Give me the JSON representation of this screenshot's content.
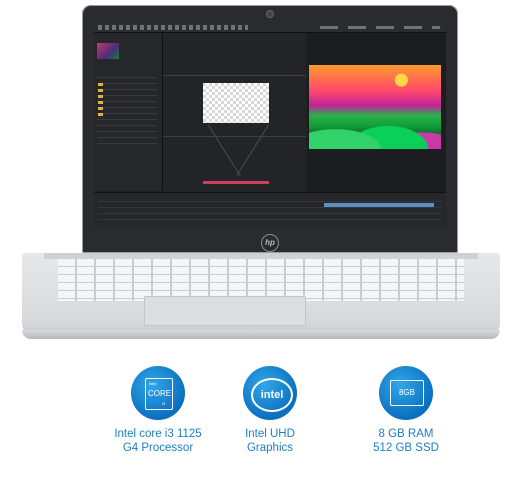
{
  "features": [
    {
      "icon": "intel-core-i3-icon",
      "badge_top": "intel",
      "badge_main": "CORE",
      "badge_sub": "i3",
      "line1": "Intel core i3 1125",
      "line2": "G4 Processor"
    },
    {
      "icon": "intel-uhd-icon",
      "badge_main": "intel",
      "line1": "Intel UHD",
      "line2": "Graphics"
    },
    {
      "icon": "memory-icon",
      "badge_main": "8GB",
      "line1": "8 GB RAM",
      "line2": "512 GB SSD"
    }
  ],
  "colors": {
    "label_blue": "#1d7ec6",
    "badge_blue": "#0b6fc0"
  }
}
